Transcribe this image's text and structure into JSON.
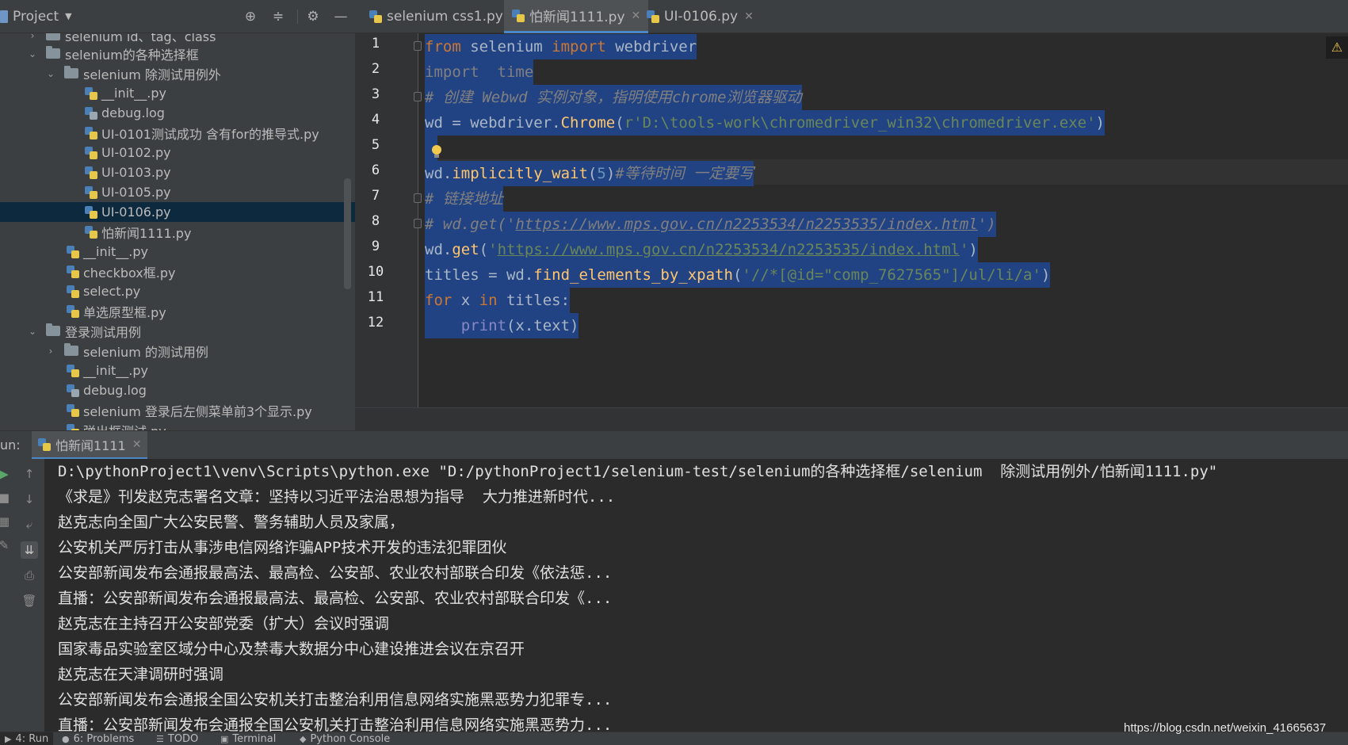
{
  "project_header": {
    "title": "Project"
  },
  "tree": [
    {
      "label": "selenium id、tag、class",
      "type": "folder",
      "expanded": false
    },
    {
      "label": "selenium的各种选择框",
      "type": "folder",
      "expanded": true
    },
    {
      "label": "selenium  除测试用例外",
      "type": "folder",
      "expanded": true
    },
    {
      "label": "__init__.py",
      "type": "py"
    },
    {
      "label": "debug.log",
      "type": "log"
    },
    {
      "label": "UI-0101测试成功  含有for的推导式.py",
      "type": "py"
    },
    {
      "label": "UI-0102.py",
      "type": "py"
    },
    {
      "label": "UI-0103.py",
      "type": "py"
    },
    {
      "label": "UI-0105.py",
      "type": "py"
    },
    {
      "label": "UI-0106.py",
      "type": "py",
      "selected": true
    },
    {
      "label": "怕新闻1111.py",
      "type": "py"
    },
    {
      "label": "__init__.py",
      "type": "py"
    },
    {
      "label": "checkbox框.py",
      "type": "py"
    },
    {
      "label": "select.py",
      "type": "py"
    },
    {
      "label": "单选原型框.py",
      "type": "py"
    },
    {
      "label": "登录测试用例",
      "type": "folder",
      "expanded": true
    },
    {
      "label": "selenium 的测试用例",
      "type": "folder",
      "expanded": false
    },
    {
      "label": "__init__.py",
      "type": "py"
    },
    {
      "label": "debug.log",
      "type": "log"
    },
    {
      "label": "selenium 登录后左侧菜单前3个显示.py",
      "type": "py"
    },
    {
      "label": "弹出框测试.py",
      "type": "py"
    }
  ],
  "tabs": [
    {
      "label": "selenium css1.py",
      "active": false
    },
    {
      "label": "怕新闻1111.py",
      "active": true
    },
    {
      "label": "UI-0106.py",
      "active": false
    }
  ],
  "code": {
    "line_numbers": [
      "1",
      "2",
      "3",
      "4",
      "5",
      "6",
      "7",
      "8",
      "9",
      "10",
      "11",
      "12"
    ],
    "lines": {
      "l1": {
        "kw1": "from",
        "t1": " selenium ",
        "kw2": "import",
        "t2": " webdriver"
      },
      "l2": {
        "kw1": "import",
        "t1": "  time"
      },
      "l3": {
        "c": "# 创建 Webwd 实例对象，指明使用chrome浏览器驱动"
      },
      "l4": {
        "a": "wd = webdriver.",
        "fn": "Chrome",
        "p1": "(",
        "s": "r'D:\\tools-work\\chromedriver_win32\\chromedriver.exe'",
        "p2": ")"
      },
      "l6": {
        "a": "wd.",
        "fn": "implicitly_wait",
        "p1": "(",
        "n": "5",
        "p2": ")",
        "c": "#等待时间 一定要写"
      },
      "l7": {
        "c": "# 链接地址"
      },
      "l8": {
        "c1": "# wd.get('",
        "u": "https://www.mps.gov.cn/n2253534/n2253535/index.html",
        "c2": "')"
      },
      "l9": {
        "a": "wd.",
        "fn": "get",
        "p1": "(",
        "s1": "'",
        "u": "https://www.mps.gov.cn/n2253534/n2253535/index.html",
        "s2": "'",
        "p2": ")"
      },
      "l10": {
        "a": "titles = wd.",
        "fn": "find_elements_by_xpath",
        "p1": "(",
        "s": "'//*[@id=\"comp_7627565\"]/ul/li/a'",
        "p2": ")"
      },
      "l11": {
        "kw1": "for",
        "t1": " x ",
        "kw2": "in",
        "t2": " titles:"
      },
      "l12": {
        "ind": "    ",
        "bi": "print",
        "t": "(x.text)"
      }
    }
  },
  "run": {
    "label": "un:",
    "tab_label": "怕新闻1111",
    "output": [
      "D:\\pythonProject1\\venv\\Scripts\\python.exe \"D:/pythonProject1/selenium-test/selenium的各种选择框/selenium  除测试用例外/怕新闻1111.py\"",
      "《求是》刊发赵克志署名文章：坚持以习近平法治思想为指导  大力推进新时代...",
      "赵克志向全国广大公安民警、警务辅助人员及家属，",
      "公安机关严厉打击从事涉电信网络诈骗APP技术开发的违法犯罪团伙",
      "公安部新闻发布会通报最高法、最高检、公安部、农业农村部联合印发《依法惩...",
      "直播：公安部新闻发布会通报最高法、最高检、公安部、农业农村部联合印发《...",
      "赵克志在主持召开公安部党委（扩大）会议时强调",
      "国家毒品实验室区域分中心及禁毒大数据分中心建设推进会议在京召开",
      "赵克志在天津调研时强调",
      "公安部新闻发布会通报全国公安机关打击整治利用信息网络实施黑恶势力犯罪专...",
      "直播：公安部新闻发布会通报全国公安机关打击整治利用信息网络实施黑恶势力..."
    ]
  },
  "statusbar": {
    "items": [
      "4: Run",
      "6: Problems",
      "TODO",
      "Terminal",
      "Python Console"
    ]
  },
  "watermark": "https://blog.csdn.net/weixin_41665637",
  "colors": {
    "keyword": "#cc7832",
    "string": "#6a8759",
    "number": "#6897bb",
    "function": "#ffc66d",
    "comment": "#629755",
    "selection": "#214283",
    "panel": "#3c3f41",
    "editor_bg": "#2b2b2b"
  }
}
